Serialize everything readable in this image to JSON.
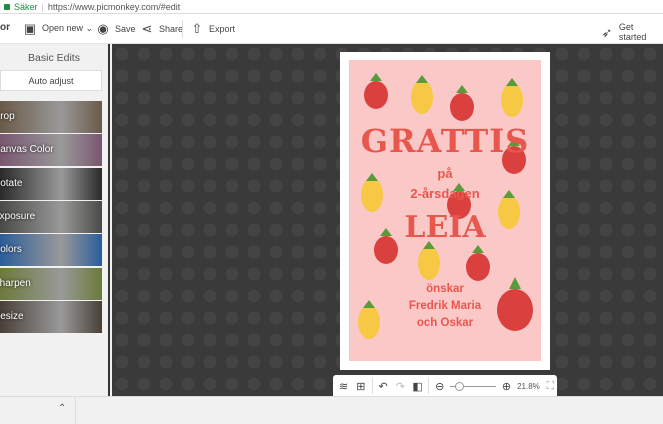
{
  "address": {
    "secure_label": "Säker",
    "url": "https://www.picmonkey.com/#edit"
  },
  "toolbar": {
    "left_fragment": "or",
    "open_new": "Open new ⌄",
    "save": "Save",
    "share": "Share",
    "export": "Export",
    "get_started": "Get started"
  },
  "sidebar": {
    "title": "Basic Edits",
    "auto_adjust": "Auto adjust",
    "tools": [
      {
        "label": "Crop",
        "bg": "#6a5a48"
      },
      {
        "label": "Canvas Color",
        "bg": "#7a5670"
      },
      {
        "label": "Rotate",
        "bg": "#2a2a2a"
      },
      {
        "label": "Exposure",
        "bg": "#4a4a48"
      },
      {
        "label": "Colors",
        "bg": "#2b5d9a"
      },
      {
        "label": "Sharpen",
        "bg": "#6b7a3a"
      },
      {
        "label": "Resize",
        "bg": "#4a4038"
      }
    ]
  },
  "card": {
    "line1": "GRATTIS",
    "line2": "på",
    "line3": "2-årsdagen",
    "line4": "LEIA",
    "line5": "önskar",
    "line6": "Fredrik Maria",
    "line7": "och Oskar",
    "bg": "#fbc8c8",
    "text_color": "#e8574d"
  },
  "zoom": {
    "level": "21.8%",
    "slider": 0.2
  }
}
